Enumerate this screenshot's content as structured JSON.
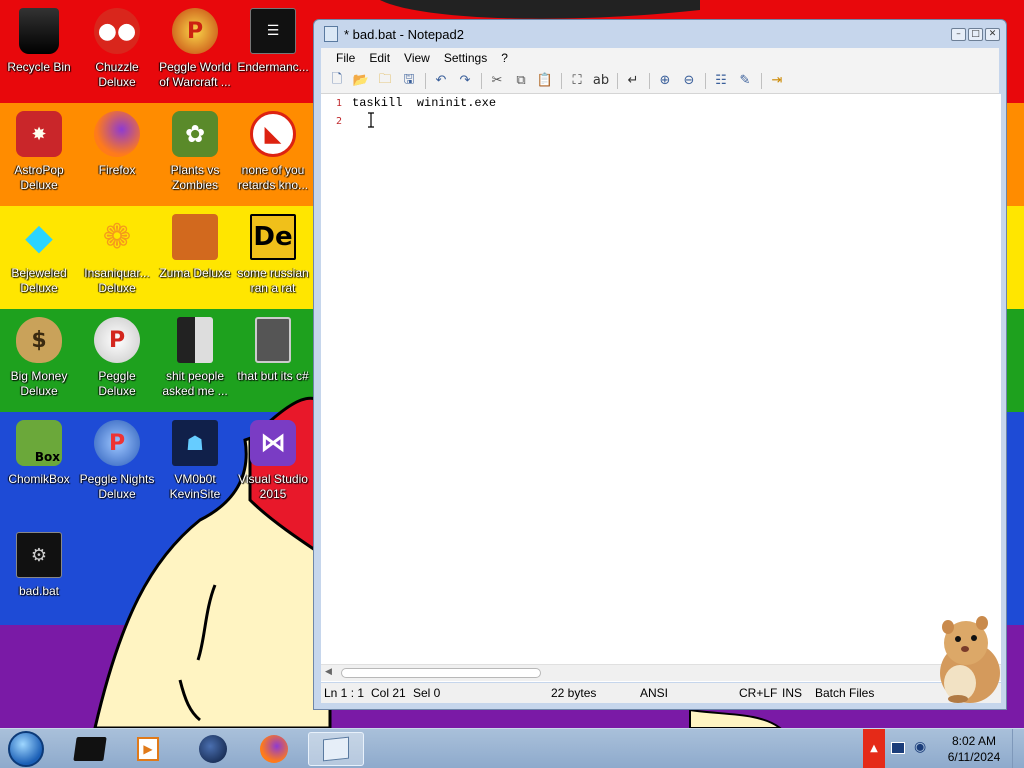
{
  "desktop": {
    "icons": [
      {
        "label": "Recycle Bin",
        "icon": "recycle-bin-icon"
      },
      {
        "label": "Chuzzle Deluxe",
        "icon": "chuzzle-icon"
      },
      {
        "label": "Peggle World of Warcraft ...",
        "icon": "peggle-wow-icon"
      },
      {
        "label": "Endermanc...",
        "icon": "endermanch-icon"
      },
      {
        "label": "AstroPop Deluxe",
        "icon": "astropop-icon"
      },
      {
        "label": "Firefox",
        "icon": "firefox-icon"
      },
      {
        "label": "Plants vs Zombies",
        "icon": "pvz-icon"
      },
      {
        "label": "none of you retards kno...",
        "icon": "red-dino-icon"
      },
      {
        "label": "Bejeweled Deluxe",
        "icon": "bejeweled-icon"
      },
      {
        "label": "Insaniquar... Deluxe",
        "icon": "insaniquarium-icon"
      },
      {
        "label": "Zuma Deluxe",
        "icon": "zuma-icon"
      },
      {
        "label": "some russian ran a rat",
        "icon": "de-icon"
      },
      {
        "label": "Big Money Deluxe",
        "icon": "money-bag-icon"
      },
      {
        "label": "Peggle Deluxe",
        "icon": "peggle-icon"
      },
      {
        "label": "shit people asked me ...",
        "icon": "folder-icon"
      },
      {
        "label": "that but its c#",
        "icon": "stack-icon"
      },
      {
        "label": "ChomikBox",
        "icon": "chomikbox-icon"
      },
      {
        "label": "Peggle Nights Deluxe",
        "icon": "peggle-nights-icon"
      },
      {
        "label": "VM0b0t KevinSite",
        "icon": "vm0b0t-icon"
      },
      {
        "label": "Visual Studio 2015",
        "icon": "visual-studio-icon"
      },
      {
        "label": "bad.bat",
        "icon": "batch-file-icon"
      }
    ]
  },
  "notepad": {
    "title": "* bad.bat - Notepad2",
    "menu": [
      "File",
      "Edit",
      "View",
      "Settings",
      "?"
    ],
    "lines": [
      {
        "num": "1",
        "text": "taskill  wininit.exe"
      },
      {
        "num": "2",
        "text": ""
      }
    ],
    "status": {
      "position": "Ln 1 : 1",
      "col": "Col 21",
      "sel": "Sel 0",
      "size": "22 bytes",
      "encoding": "ANSI",
      "eol": "CR+LF",
      "mode": "INS",
      "scheme": "Batch Files"
    }
  },
  "taskbar": {
    "time": "8:02 AM",
    "date": "6/11/2024"
  },
  "colors": {
    "line_number": "#c0292d",
    "window_frame": "#c6d6ec",
    "taskbar": "#a9c0da"
  }
}
